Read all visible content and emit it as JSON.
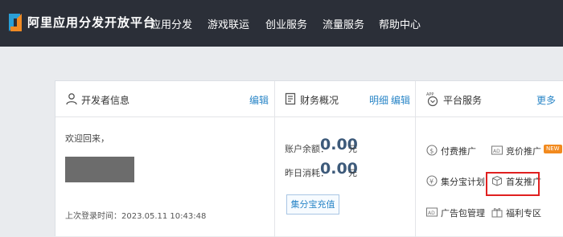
{
  "brand": "阿里应用分发开放平台",
  "nav": [
    "应用分发",
    "游戏联运",
    "创业服务",
    "流量服务",
    "帮助中心"
  ],
  "developer": {
    "title": "开发者信息",
    "edit": "编辑",
    "welcome": "欢迎回来，",
    "last_login": "上次登录时间：2023.05.11 10:43:48"
  },
  "finance": {
    "title": "财务概况",
    "detail": "明细",
    "edit": "编辑",
    "balance_label": "账户余额：",
    "balance": "0.00",
    "balance_unit": "元",
    "yesterday_label": "昨日消耗：",
    "yesterday": "0.00",
    "yesterday_unit": "元",
    "recharge": "集分宝充值"
  },
  "services": {
    "title": "平台服务",
    "more": "更多",
    "items": [
      "付费推广",
      "竞价推广",
      "集分宝计划",
      "首发推广",
      "广告包管理",
      "福利专区"
    ],
    "new_badge": "NEW"
  },
  "colors": {
    "topbar": "#2b2f38",
    "link": "#2a86c7",
    "amount": "#3d5a7a",
    "highlight": "#e02020",
    "badge": "#f28a1e"
  }
}
